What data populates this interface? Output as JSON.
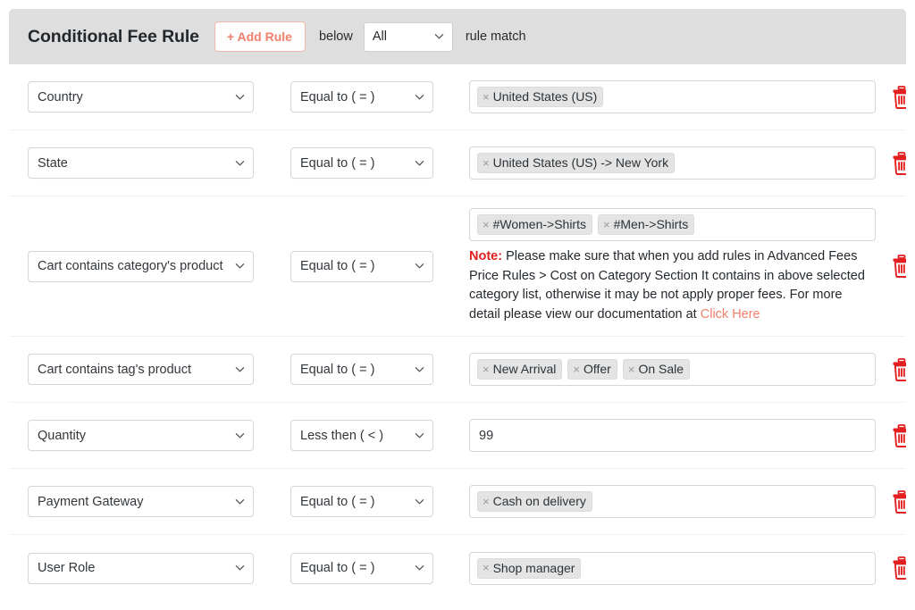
{
  "header": {
    "title": "Conditional Fee Rule",
    "add_rule_label": "+ Add Rule",
    "below_label": "below",
    "match_select_value": "All",
    "rule_match_label": "rule match"
  },
  "icons": {
    "chevron_down": "chevron-down-icon",
    "trash": "trash-icon",
    "chip_remove": "×"
  },
  "rows": [
    {
      "condition": "Country",
      "operator": "Equal to ( = )",
      "value_type": "chips",
      "chips": [
        "United States (US)"
      ]
    },
    {
      "condition": "State",
      "operator": "Equal to ( = )",
      "value_type": "chips",
      "chips": [
        "United States (US) -> New York"
      ]
    },
    {
      "condition": "Cart contains category's product",
      "operator": "Equal to ( = )",
      "value_type": "chips",
      "chips": [
        "#Women->Shirts",
        "#Men->Shirts"
      ],
      "note": {
        "label": "Note:",
        "text": " Please make sure that when you add rules in Advanced Fees Price Rules > Cost on Category Section It contains in above selected category list, otherwise it may be not apply proper fees. For more detail please view our documentation at ",
        "link_text": "Click Here"
      }
    },
    {
      "condition": "Cart contains tag's product",
      "operator": "Equal to ( = )",
      "value_type": "chips",
      "chips": [
        "New Arrival",
        "Offer",
        "On Sale"
      ]
    },
    {
      "condition": "Quantity",
      "operator": "Less then ( < )",
      "value_type": "text",
      "text_value": "99"
    },
    {
      "condition": "Payment Gateway",
      "operator": "Equal to ( = )",
      "value_type": "chips",
      "chips": [
        "Cash on delivery"
      ]
    },
    {
      "condition": "User Role",
      "operator": "Equal to ( = )",
      "value_type": "chips",
      "chips": [
        "Shop manager"
      ]
    }
  ],
  "colors": {
    "accent": "#f0806c",
    "note_red": "#e02020",
    "trash_red": "#e41f1f",
    "header_bg": "#dedede"
  }
}
